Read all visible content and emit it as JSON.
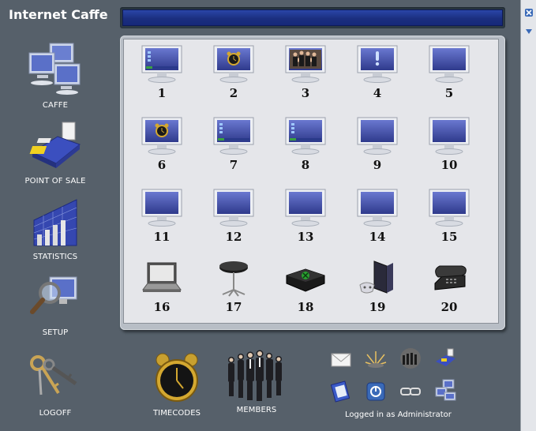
{
  "app": {
    "title": "Internet Caffe"
  },
  "sidebar": {
    "items": [
      {
        "label": "CAFFE",
        "icon": "computers-icon"
      },
      {
        "label": "POINT OF SALE",
        "icon": "cash-register-icon"
      },
      {
        "label": "STATISTICS",
        "icon": "bar-chart-icon"
      },
      {
        "label": "SETUP",
        "icon": "magnifier-monitor-icon"
      }
    ]
  },
  "bottom": {
    "logoff_label": "LOGOFF",
    "timecodes_label": "TIMECODES",
    "members_label": "MEMBERS",
    "status": "Logged in as Administrator"
  },
  "stations": [
    {
      "number": "1",
      "screen": "desktop"
    },
    {
      "number": "2",
      "screen": "alarm-clock"
    },
    {
      "number": "3",
      "screen": "people-photo"
    },
    {
      "number": "4",
      "screen": "exclamation"
    },
    {
      "number": "5",
      "screen": "blank"
    },
    {
      "number": "6",
      "screen": "alarm-clock"
    },
    {
      "number": "7",
      "screen": "desktop"
    },
    {
      "number": "8",
      "screen": "desktop"
    },
    {
      "number": "9",
      "screen": "blank"
    },
    {
      "number": "10",
      "screen": "blank"
    },
    {
      "number": "11",
      "screen": "blank"
    },
    {
      "number": "12",
      "screen": "blank"
    },
    {
      "number": "13",
      "screen": "blank"
    },
    {
      "number": "14",
      "screen": "blank"
    },
    {
      "number": "15",
      "screen": "blank"
    },
    {
      "number": "16",
      "device": "laptop-icon"
    },
    {
      "number": "17",
      "device": "table-icon"
    },
    {
      "number": "18",
      "device": "game-console-icon"
    },
    {
      "number": "19",
      "device": "playstation-icon"
    },
    {
      "number": "20",
      "device": "telephone-icon"
    }
  ],
  "colors": {
    "background": "#56606a",
    "panel": "#e5e6ea",
    "screen": "#3e4aa0"
  }
}
